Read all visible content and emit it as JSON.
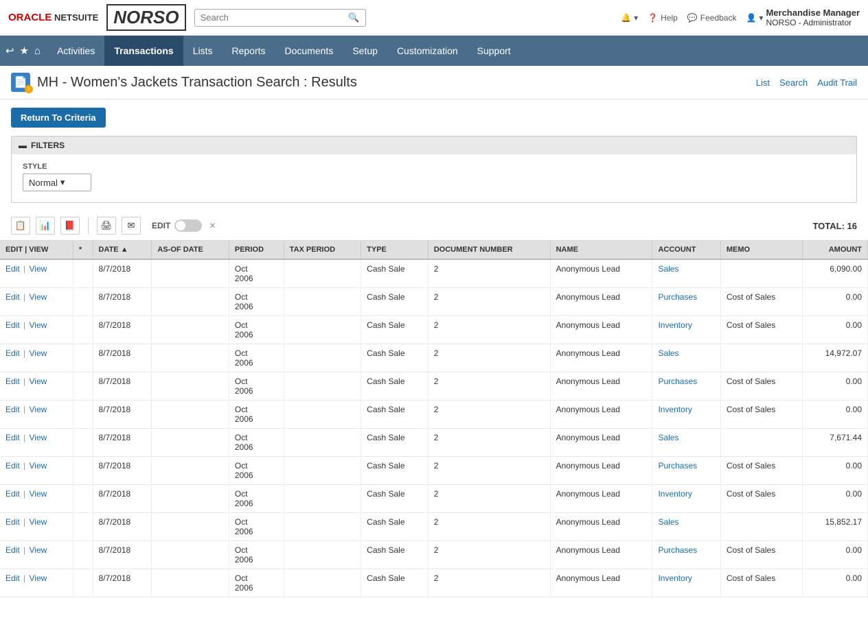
{
  "topBar": {
    "logoOracle": "ORACLE",
    "logoNetsuite": "NETSUITE",
    "logoNorso": "NORSO",
    "searchPlaceholder": "Search",
    "helpLabel": "Help",
    "feedbackLabel": "Feedback",
    "userName": "Merchandise Manager",
    "userRole": "NORSO - Administrator"
  },
  "nav": {
    "items": [
      {
        "label": "Activities",
        "active": false
      },
      {
        "label": "Transactions",
        "active": true
      },
      {
        "label": "Lists",
        "active": false
      },
      {
        "label": "Reports",
        "active": false
      },
      {
        "label": "Documents",
        "active": false
      },
      {
        "label": "Setup",
        "active": false
      },
      {
        "label": "Customization",
        "active": false
      },
      {
        "label": "Support",
        "active": false
      }
    ]
  },
  "page": {
    "title": "MH - Women's Jackets Transaction Search : Results",
    "links": [
      "List",
      "Search",
      "Audit Trail"
    ],
    "returnBtn": "Return To Criteria"
  },
  "filters": {
    "header": "FILTERS",
    "styleLabel": "STYLE",
    "styleValue": "Normal"
  },
  "toolbar": {
    "editLabel": "EDIT",
    "total": "TOTAL: 16"
  },
  "table": {
    "columns": [
      "EDIT | VIEW",
      "*",
      "DATE ▲",
      "AS-OF DATE",
      "PERIOD",
      "TAX PERIOD",
      "TYPE",
      "DOCUMENT NUMBER",
      "NAME",
      "ACCOUNT",
      "MEMO",
      "AMOUNT"
    ],
    "rows": [
      {
        "editView": "Edit | View",
        "star": "",
        "date": "8/7/2018",
        "asOfDate": "",
        "period": "Oct\n2006",
        "taxPeriod": "",
        "type": "Cash Sale",
        "docNumber": "2",
        "name": "Anonymous Lead",
        "account": "Sales",
        "memo": "",
        "amount": "6,090.00"
      },
      {
        "editView": "Edit | View",
        "star": "",
        "date": "8/7/2018",
        "asOfDate": "",
        "period": "Oct\n2006",
        "taxPeriod": "",
        "type": "Cash Sale",
        "docNumber": "2",
        "name": "Anonymous Lead",
        "account": "Purchases",
        "memo": "Cost of Sales",
        "amount": "0.00"
      },
      {
        "editView": "Edit | View",
        "star": "",
        "date": "8/7/2018",
        "asOfDate": "",
        "period": "Oct\n2006",
        "taxPeriod": "",
        "type": "Cash Sale",
        "docNumber": "2",
        "name": "Anonymous Lead",
        "account": "Inventory",
        "memo": "Cost of Sales",
        "amount": "0.00"
      },
      {
        "editView": "Edit | View",
        "star": "",
        "date": "8/7/2018",
        "asOfDate": "",
        "period": "Oct\n2006",
        "taxPeriod": "",
        "type": "Cash Sale",
        "docNumber": "2",
        "name": "Anonymous Lead",
        "account": "Sales",
        "memo": "",
        "amount": "14,972.07"
      },
      {
        "editView": "Edit | View",
        "star": "",
        "date": "8/7/2018",
        "asOfDate": "",
        "period": "Oct\n2006",
        "taxPeriod": "",
        "type": "Cash Sale",
        "docNumber": "2",
        "name": "Anonymous Lead",
        "account": "Purchases",
        "memo": "Cost of Sales",
        "amount": "0.00"
      },
      {
        "editView": "Edit | View",
        "star": "",
        "date": "8/7/2018",
        "asOfDate": "",
        "period": "Oct\n2006",
        "taxPeriod": "",
        "type": "Cash Sale",
        "docNumber": "2",
        "name": "Anonymous Lead",
        "account": "Inventory",
        "memo": "Cost of Sales",
        "amount": "0.00"
      },
      {
        "editView": "Edit | View",
        "star": "",
        "date": "8/7/2018",
        "asOfDate": "",
        "period": "Oct\n2006",
        "taxPeriod": "",
        "type": "Cash Sale",
        "docNumber": "2",
        "name": "Anonymous Lead",
        "account": "Sales",
        "memo": "",
        "amount": "7,671.44"
      },
      {
        "editView": "Edit | View",
        "star": "",
        "date": "8/7/2018",
        "asOfDate": "",
        "period": "Oct\n2006",
        "taxPeriod": "",
        "type": "Cash Sale",
        "docNumber": "2",
        "name": "Anonymous Lead",
        "account": "Purchases",
        "memo": "Cost of Sales",
        "amount": "0.00"
      },
      {
        "editView": "Edit | View",
        "star": "",
        "date": "8/7/2018",
        "asOfDate": "",
        "period": "Oct\n2006",
        "taxPeriod": "",
        "type": "Cash Sale",
        "docNumber": "2",
        "name": "Anonymous Lead",
        "account": "Inventory",
        "memo": "Cost of Sales",
        "amount": "0.00"
      },
      {
        "editView": "Edit | View",
        "star": "",
        "date": "8/7/2018",
        "asOfDate": "",
        "period": "Oct\n2006",
        "taxPeriod": "",
        "type": "Cash Sale",
        "docNumber": "2",
        "name": "Anonymous Lead",
        "account": "Sales",
        "memo": "",
        "amount": "15,852.17"
      },
      {
        "editView": "Edit | View",
        "star": "",
        "date": "8/7/2018",
        "asOfDate": "",
        "period": "Oct\n2006",
        "taxPeriod": "",
        "type": "Cash Sale",
        "docNumber": "2",
        "name": "Anonymous Lead",
        "account": "Purchases",
        "memo": "Cost of Sales",
        "amount": "0.00"
      },
      {
        "editView": "Edit | View",
        "star": "",
        "date": "8/7/2018",
        "asOfDate": "",
        "period": "Oct\n2006",
        "taxPeriod": "",
        "type": "Cash Sale",
        "docNumber": "2",
        "name": "Anonymous Lead",
        "account": "Inventory",
        "memo": "Cost of Sales",
        "amount": "0.00"
      }
    ],
    "accountLinks": [
      "Sales",
      "Purchases",
      "Inventory"
    ]
  }
}
